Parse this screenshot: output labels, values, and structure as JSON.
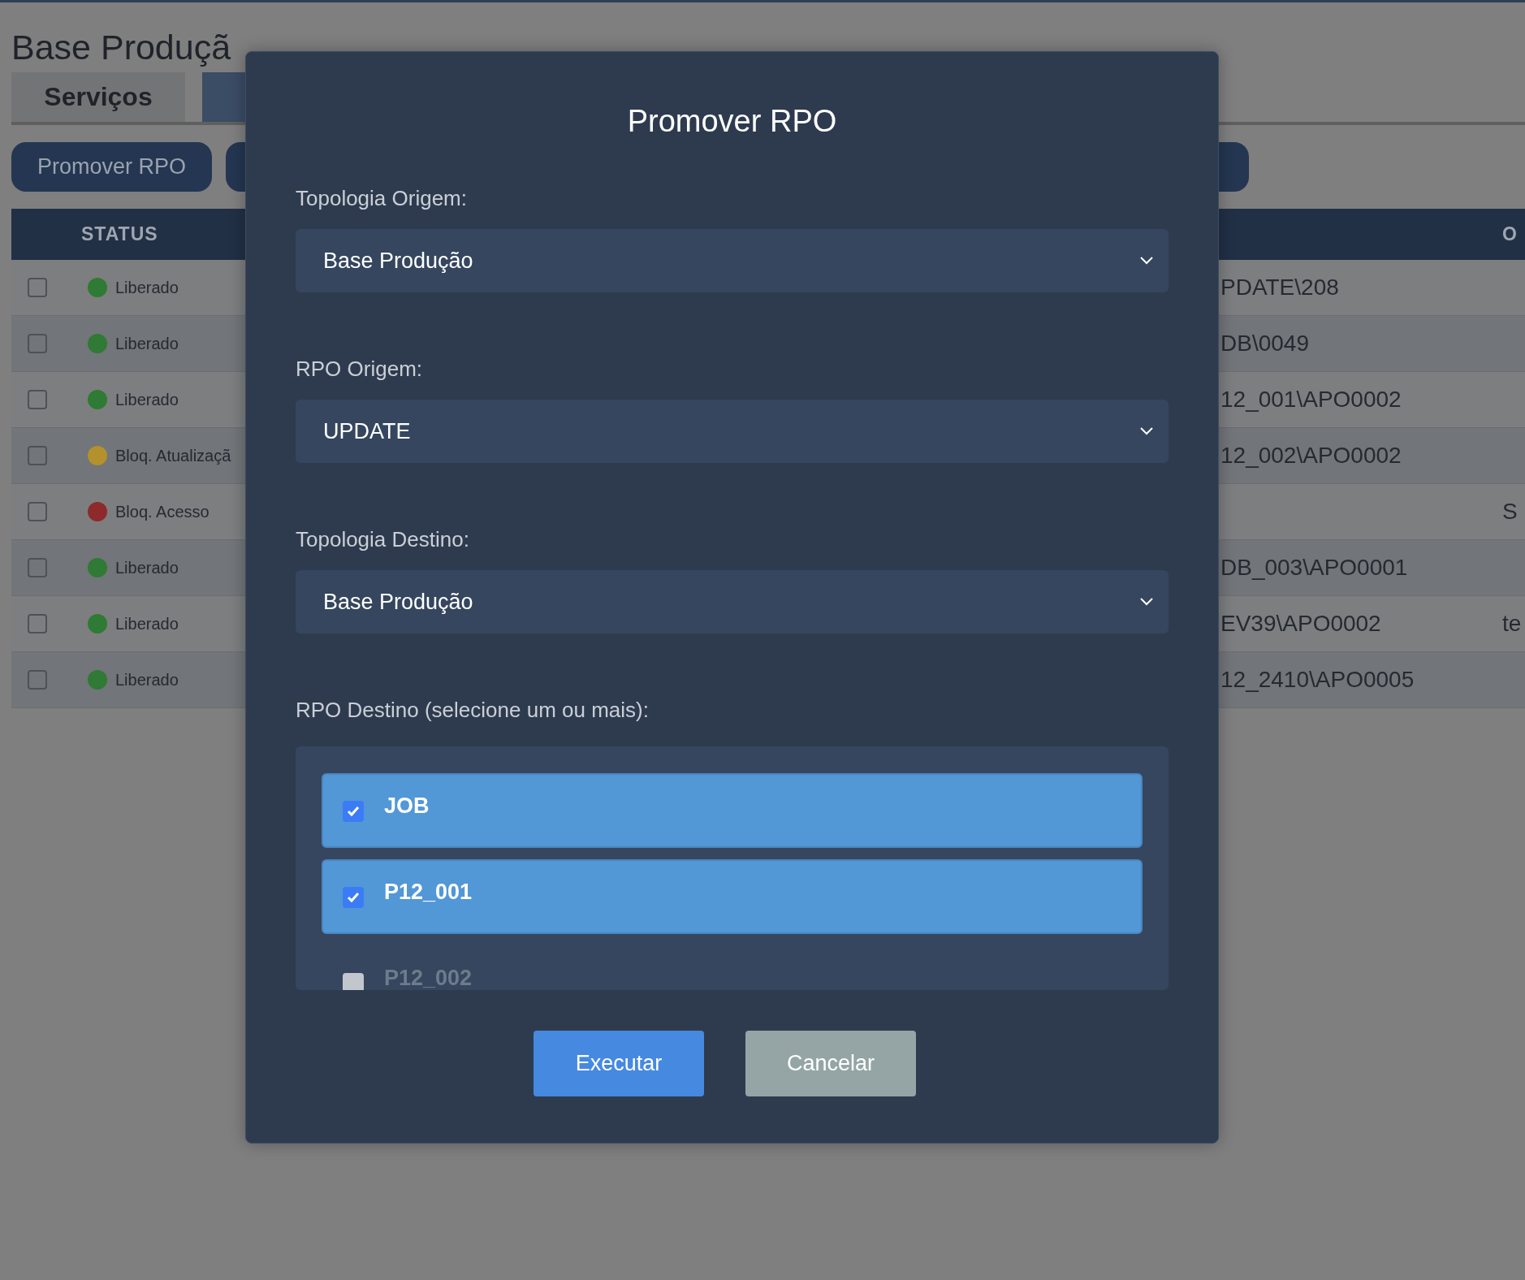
{
  "page": {
    "title": "Base Produçã"
  },
  "tabs": [
    {
      "label": "Serviços",
      "selected": false
    },
    {
      "selected": true
    }
  ],
  "toolbar": [
    {
      "kind": "text",
      "label": "Promover RPO"
    },
    {
      "kind": "blank"
    },
    {
      "kind": "blank"
    }
  ],
  "table": {
    "columns": [
      {
        "label": "STATUS"
      },
      {
        "label": "O"
      }
    ],
    "rows": [
      {
        "checked": false,
        "status": "Liberado",
        "color": "#2f7a34",
        "column_3": "PDATE\\208"
      },
      {
        "checked": false,
        "status": "Liberado",
        "color": "#2f7a34",
        "column_3": "DB\\0049"
      },
      {
        "checked": false,
        "status": "Liberado",
        "color": "#2f7a34",
        "column_3": "12_001\\APO0002"
      },
      {
        "checked": false,
        "status": "Bloq. Atualizaçã",
        "color": "#b3912c",
        "column_3": "12_002\\APO0002"
      },
      {
        "checked": false,
        "status": "Bloq. Acesso",
        "color": "#8e2a2c",
        "column_4": "S"
      },
      {
        "checked": false,
        "status": "Liberado",
        "color": "#2f7a34",
        "column_3": "DB_003\\APO0001"
      },
      {
        "checked": false,
        "status": "Liberado",
        "color": "#2f7a34",
        "column_3": "EV39\\APO0002",
        "column_4": "te"
      },
      {
        "checked": false,
        "status": "Liberado",
        "color": "#2f7a34",
        "column_3": "12_2410\\APO0005"
      }
    ]
  },
  "modal": {
    "title": "Promover RPO",
    "fields": [
      {
        "label": "Topologia Origem:",
        "value": "Base Produção"
      },
      {
        "label": "RPO Origem:",
        "value": "UPDATE"
      },
      {
        "label": "Topologia Destino:",
        "value": "Base Produção"
      }
    ],
    "destinations": {
      "label": "RPO Destino (selecione um ou mais):",
      "options": [
        {
          "label": "JOB",
          "checked": true
        },
        {
          "label": "P12_001",
          "checked": true
        },
        {
          "label": "P12_002",
          "checked": false
        }
      ]
    },
    "buttons": [
      {
        "kind": "primary",
        "label": "Executar"
      },
      {
        "kind": "secondary",
        "label": "Cancelar"
      }
    ]
  }
}
